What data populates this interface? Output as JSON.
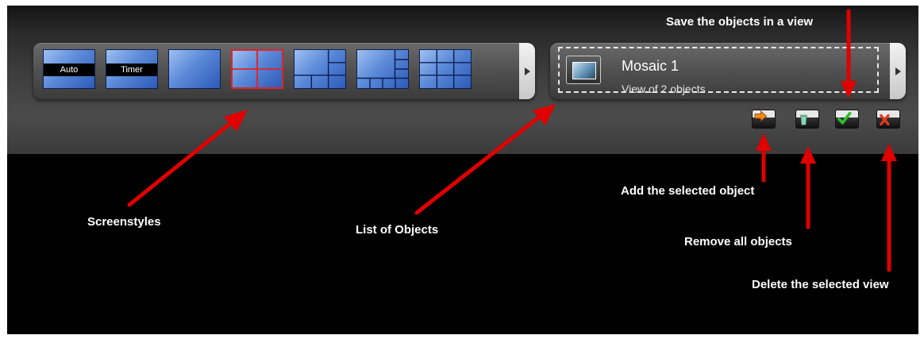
{
  "screenstyles": {
    "tiles": [
      {
        "label": "Auto"
      },
      {
        "label": "Timer"
      },
      {
        "label": ""
      },
      {
        "label": ""
      },
      {
        "label": ""
      },
      {
        "label": ""
      },
      {
        "label": ""
      }
    ],
    "selected_index": 3
  },
  "objects_panel": {
    "view_title": "Mosaic 1",
    "view_subtitle": "View of 2 objects"
  },
  "actions": {
    "add_icon": "add-arrow-icon",
    "remove_icon": "trash-icon",
    "save_icon": "check-icon",
    "delete_icon": "x-icon"
  },
  "annotations": {
    "screenstyles": "Screenstyles",
    "list_of_objects": "List of Objects",
    "save_view": "Save the objects in a view",
    "add_selected": "Add the selected object",
    "remove_all": "Remove all objects",
    "delete_view": "Delete the selected view"
  },
  "colors": {
    "arrow": "#e00000",
    "selected_border": "#e0242a"
  }
}
